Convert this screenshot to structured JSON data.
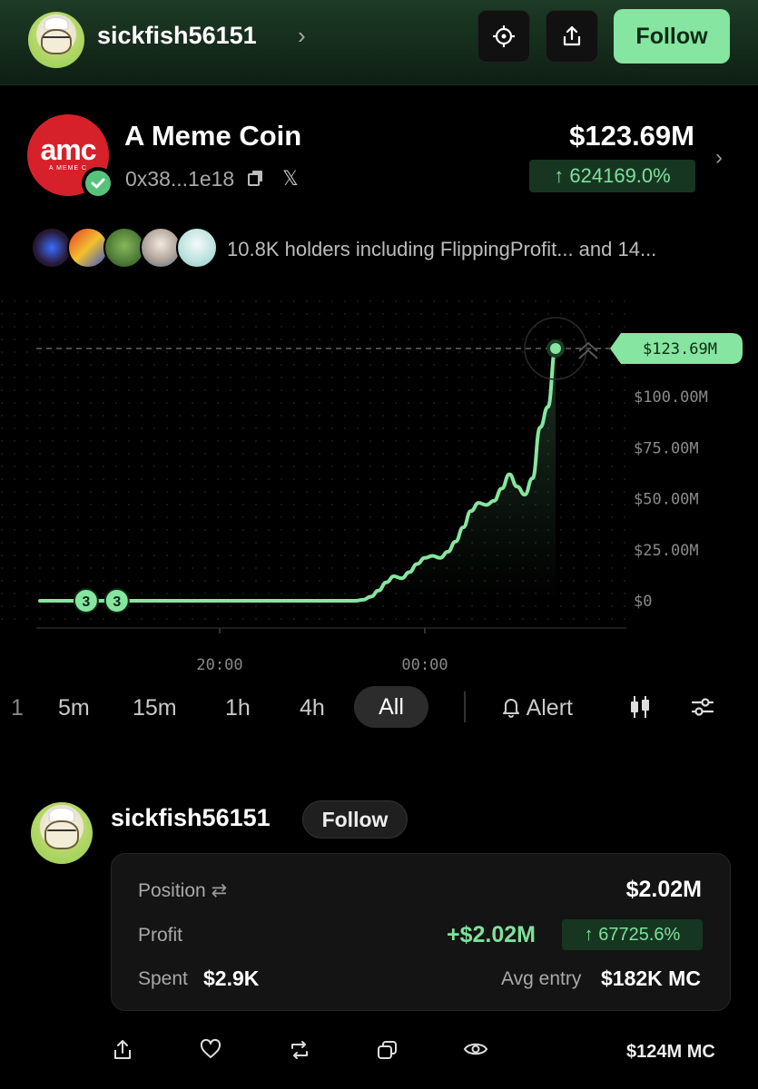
{
  "header": {
    "username": "sickfish56151",
    "follow_label": "Follow",
    "icons": [
      "crosshair-icon",
      "share-icon"
    ]
  },
  "coin": {
    "name": "A Meme Coin",
    "logo_text": "amc",
    "logo_subtext": "A MEME C",
    "address": "0x38...1e18",
    "market_cap": "$123.69M",
    "change": "↑ 624169.0%",
    "holders_text": "10.8K holders including FlippingProfit... and 14..."
  },
  "colors": {
    "accent_green": "#86e5a0",
    "line_green": "#7ee29b",
    "logo_red": "#d7212a"
  },
  "chart_data": {
    "type": "line",
    "x_tick_labels": [
      "20:00",
      "00:00"
    ],
    "y_tick_labels": [
      "$0",
      "$25.00M",
      "$50.00M",
      "$75.00M",
      "$100.00M"
    ],
    "ylim": [
      0,
      123.69
    ],
    "y_units": "$M",
    "current_label": "$123.69M",
    "trade_markers": [
      "3",
      "3"
    ],
    "series": [
      {
        "values": [
          0,
          0,
          0,
          0,
          0,
          0,
          0,
          0,
          0,
          0,
          0,
          0,
          0,
          0,
          0,
          0,
          0,
          0,
          0,
          0,
          0,
          0,
          0,
          0,
          0,
          0,
          0,
          0,
          0,
          0,
          0,
          0,
          0,
          0,
          0,
          0,
          0,
          0,
          0,
          0,
          0,
          0,
          0.5,
          2,
          5,
          9,
          12,
          11,
          14,
          18,
          21,
          22,
          21,
          24,
          29,
          36,
          44,
          48,
          47,
          49,
          55,
          62,
          56,
          52,
          60,
          85,
          95,
          123.69
        ]
      }
    ]
  },
  "timeframes": {
    "items": [
      "1",
      "5m",
      "15m",
      "1h",
      "4h"
    ],
    "selected": "All",
    "alert_label": "Alert"
  },
  "post": {
    "username": "sickfish56151",
    "follow_label": "Follow",
    "position_label": "Position",
    "position_value": "$2.02M",
    "profit_label": "Profit",
    "profit_value": "+$2.02M",
    "profit_change": "↑ 67725.6%",
    "spent_label": "Spent",
    "spent_value": "$2.9K",
    "avg_entry_label": "Avg entry",
    "avg_entry_value": "$182K MC",
    "footer_mc": "$124M MC"
  }
}
